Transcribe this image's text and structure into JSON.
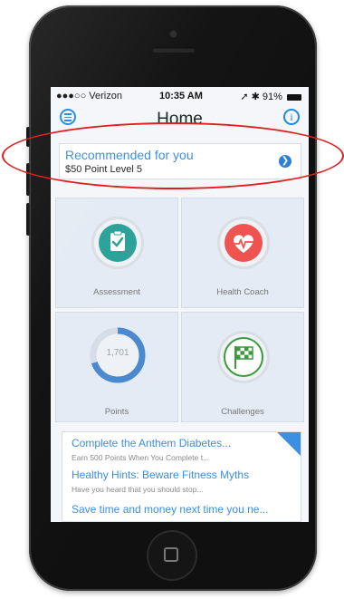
{
  "status": {
    "carrier": "●●●○○ Verizon",
    "time": "10:35 AM",
    "battery": "91%"
  },
  "nav": {
    "title": "Home"
  },
  "recommended": {
    "title": "Recommended for you",
    "subtitle": "$50 Point Level 5"
  },
  "tiles": [
    {
      "label": "Assessment",
      "icon": "clipboard-check-icon",
      "color": "#2aa198"
    },
    {
      "label": "Health Coach",
      "icon": "heart-pulse-icon",
      "color": "#ef5350"
    },
    {
      "label": "Points",
      "value": "1,701",
      "progress": 0.7,
      "color": "#4a88cf"
    },
    {
      "label": "Challenges",
      "icon": "checkered-flag-icon",
      "color": "#3c9a3c"
    }
  ],
  "feed": [
    {
      "title": "Complete the Anthem Diabetes...",
      "subtitle": "Earn 500 Points When You Complete t..."
    },
    {
      "title": "Healthy Hints: Beware Fitness Myths",
      "subtitle": "Have you heard that you should stop..."
    },
    {
      "title": "Save time and money next time you ne...",
      "subtitle": ""
    }
  ],
  "colors": {
    "accent": "#1d8ae0",
    "highlight": "#e01f1f"
  }
}
